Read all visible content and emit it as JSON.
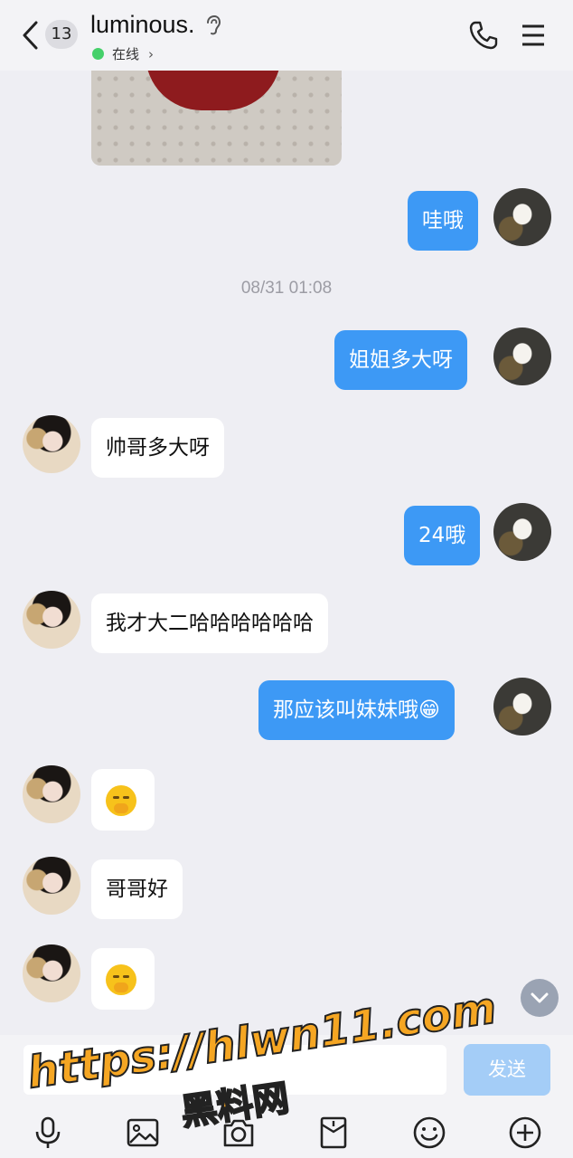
{
  "header": {
    "back_count": "13",
    "contact_name": "luminous.",
    "status_text": "在线",
    "status_color": "#45d06a"
  },
  "timestamp": "08/31 01:08",
  "messages": [
    {
      "from": "me",
      "text": "哇哦"
    },
    {
      "from": "me",
      "text": "姐姐多大呀"
    },
    {
      "from": "them",
      "text": "帅哥多大呀"
    },
    {
      "from": "me",
      "text": "24哦"
    },
    {
      "from": "them",
      "text": "我才大二哈哈哈哈哈哈"
    },
    {
      "from": "me",
      "text": "那应该叫妹妹哦😁"
    },
    {
      "from": "them",
      "sticker": "face-with-hand-over-mouth-emoji"
    },
    {
      "from": "them",
      "text": "哥哥好"
    },
    {
      "from": "them",
      "sticker": "face-with-hand-over-mouth-emoji"
    }
  ],
  "composer": {
    "send_label": "发送",
    "input_value": ""
  },
  "toolbar_icons": [
    "microphone-icon",
    "image-icon",
    "camera-icon",
    "red-packet-icon",
    "emoji-icon",
    "plus-icon"
  ],
  "watermark": {
    "line1": "https://hlwn11.com",
    "line2": "黑料网"
  },
  "colors": {
    "my_bubble": "#3d99f5",
    "their_bubble": "#ffffff",
    "background": "#eeeef3",
    "send_button": "#a4cdf7"
  }
}
